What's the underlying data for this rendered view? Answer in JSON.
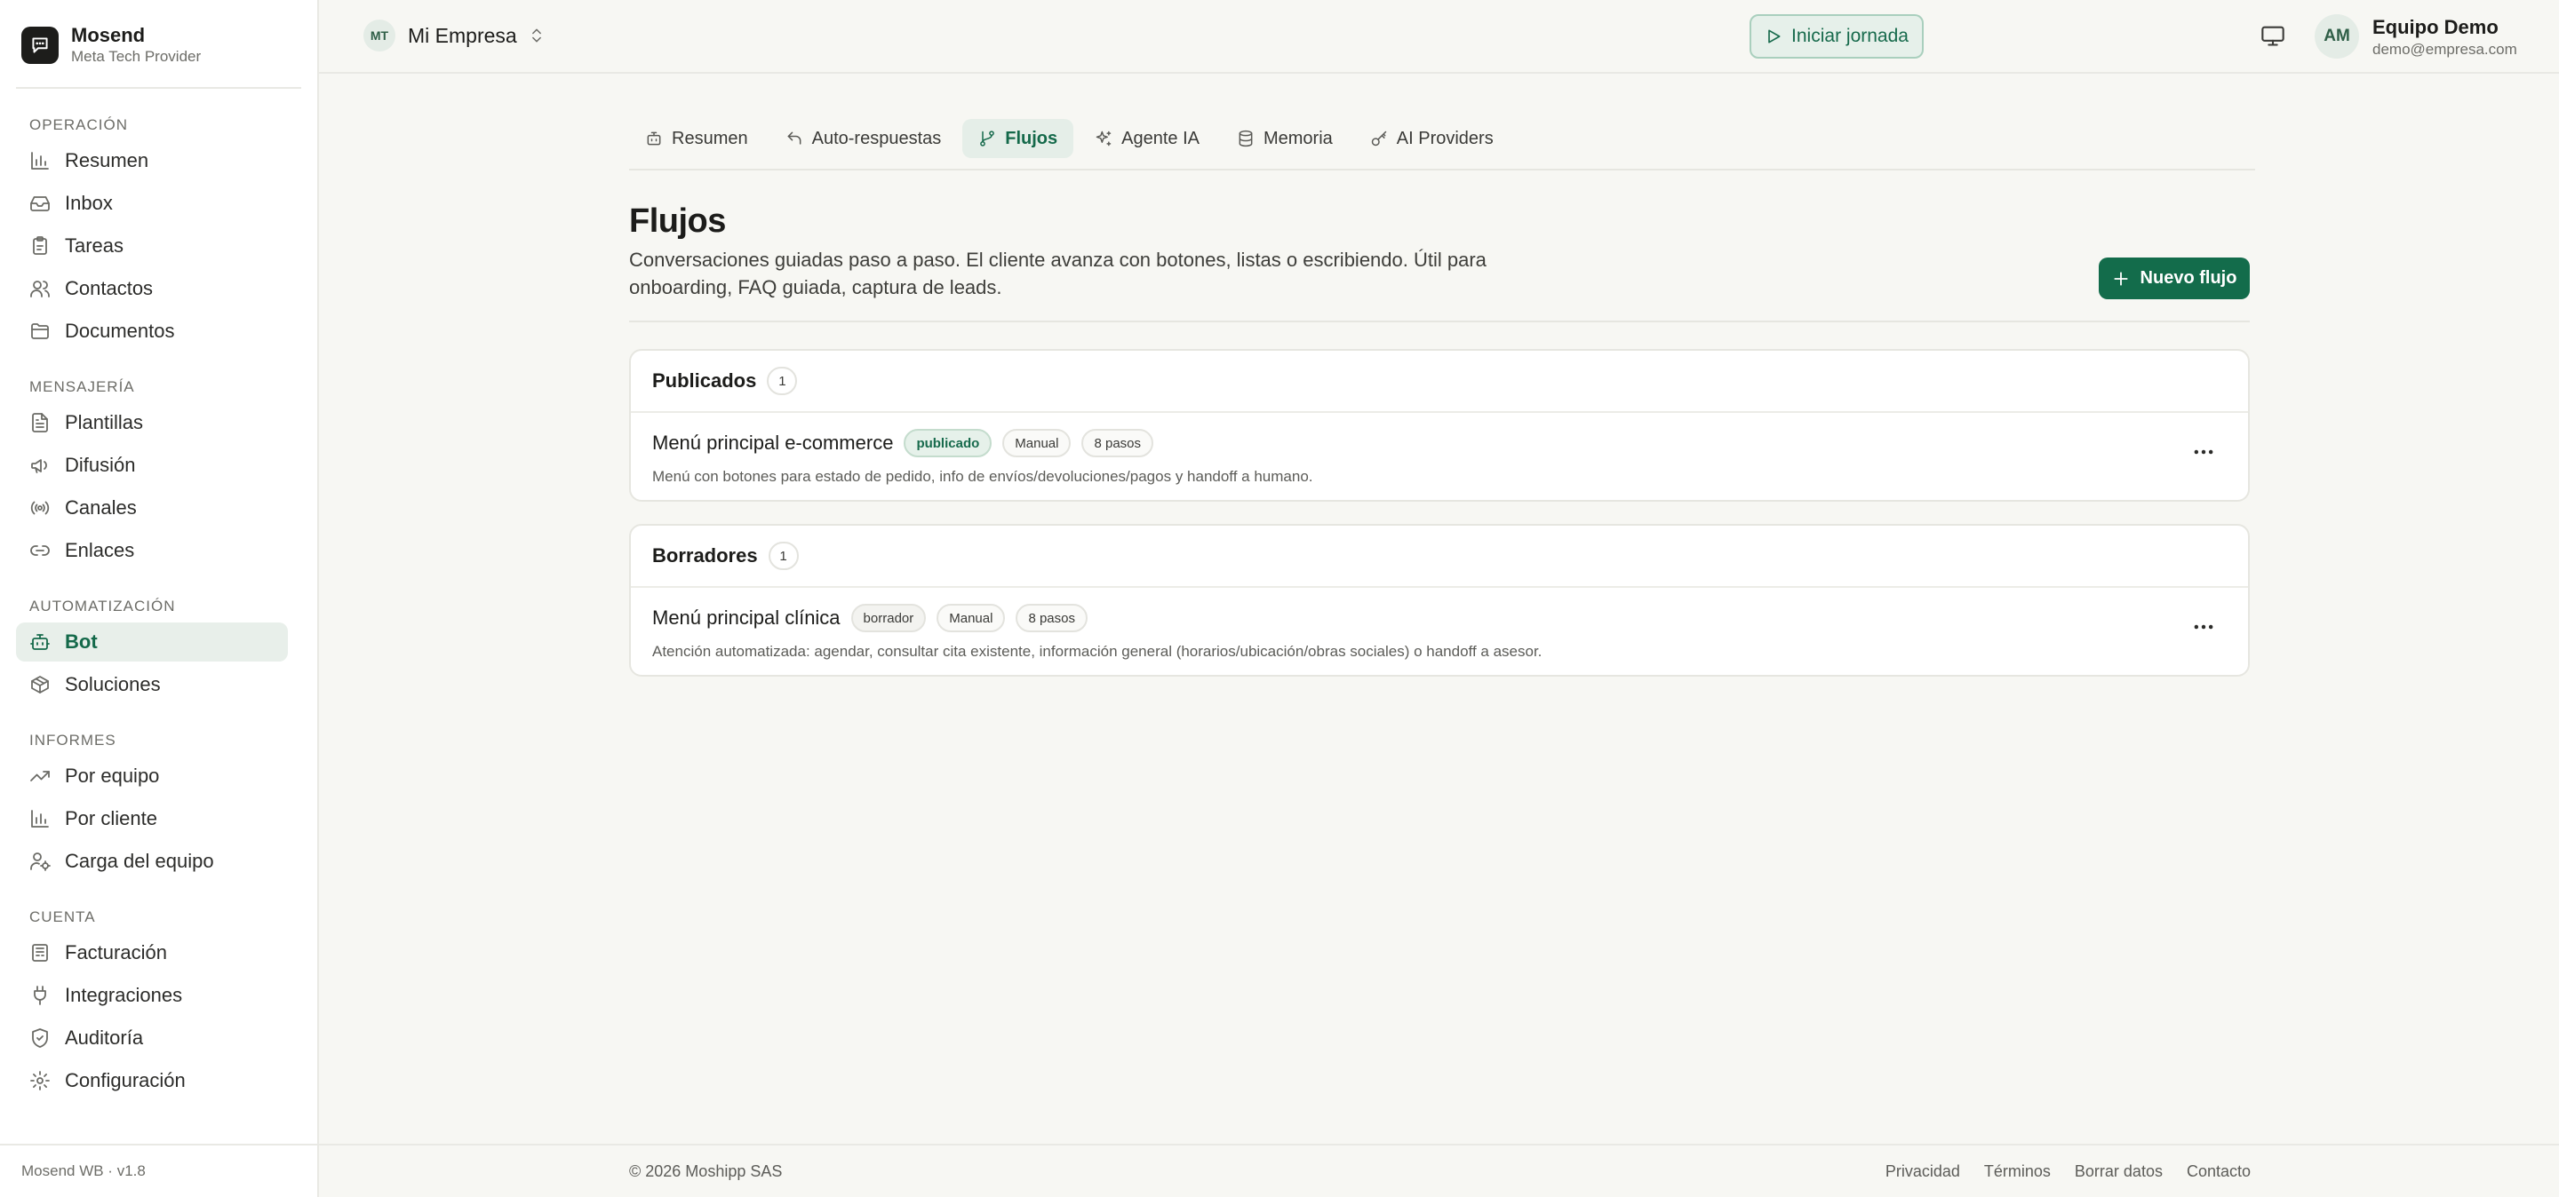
{
  "brand": {
    "name": "Mosend",
    "subtitle": "Meta Tech Provider"
  },
  "sidebar": {
    "sections": [
      {
        "title": "Operación",
        "items": [
          {
            "label": "Resumen",
            "icon": "bar-chart-icon"
          },
          {
            "label": "Inbox",
            "icon": "inbox-icon"
          },
          {
            "label": "Tareas",
            "icon": "clipboard-icon"
          },
          {
            "label": "Contactos",
            "icon": "users-icon"
          },
          {
            "label": "Documentos",
            "icon": "folder-icon"
          }
        ]
      },
      {
        "title": "Mensajería",
        "items": [
          {
            "label": "Plantillas",
            "icon": "file-text-icon"
          },
          {
            "label": "Difusión",
            "icon": "megaphone-icon"
          },
          {
            "label": "Canales",
            "icon": "radio-icon"
          },
          {
            "label": "Enlaces",
            "icon": "link-icon"
          }
        ]
      },
      {
        "title": "Automatización",
        "items": [
          {
            "label": "Bot",
            "icon": "bot-icon",
            "active": true
          },
          {
            "label": "Soluciones",
            "icon": "package-icon"
          }
        ]
      },
      {
        "title": "Informes",
        "items": [
          {
            "label": "Por equipo",
            "icon": "trending-up-icon"
          },
          {
            "label": "Por cliente",
            "icon": "bar-chart-icon"
          },
          {
            "label": "Carga del equipo",
            "icon": "user-cog-icon"
          }
        ]
      },
      {
        "title": "Cuenta",
        "items": [
          {
            "label": "Facturación",
            "icon": "receipt-icon"
          },
          {
            "label": "Integraciones",
            "icon": "plug-icon"
          },
          {
            "label": "Auditoría",
            "icon": "shield-icon"
          },
          {
            "label": "Configuración",
            "icon": "gear-icon"
          }
        ]
      }
    ],
    "footer": "Mosend WB · v1.8"
  },
  "topbar": {
    "workspace_initials": "MT",
    "workspace_name": "Mi Empresa",
    "start_label": "Iniciar jornada",
    "user_initials": "AM",
    "user_name": "Equipo Demo",
    "user_email": "demo@empresa.com"
  },
  "tabs": [
    {
      "label": "Resumen",
      "icon": "bot-icon"
    },
    {
      "label": "Auto-respuestas",
      "icon": "reply-icon"
    },
    {
      "label": "Flujos",
      "icon": "git-branch-icon",
      "active": true
    },
    {
      "label": "Agente IA",
      "icon": "sparkles-icon"
    },
    {
      "label": "Memoria",
      "icon": "database-icon"
    },
    {
      "label": "AI Providers",
      "icon": "key-icon"
    }
  ],
  "page": {
    "title": "Flujos",
    "description": "Conversaciones guiadas paso a paso. El cliente avanza con botones, listas o escribiendo. Útil para onboarding, FAQ guiada, captura de leads.",
    "new_button": "Nuevo flujo"
  },
  "groups": [
    {
      "title": "Publicados",
      "count": "1",
      "flows": [
        {
          "name": "Menú principal e-commerce",
          "status": "publicado",
          "trigger": "Manual",
          "steps": "8 pasos",
          "description": "Menú con botones para estado de pedido, info de envíos/devoluciones/pagos y handoff a humano."
        }
      ]
    },
    {
      "title": "Borradores",
      "count": "1",
      "flows": [
        {
          "name": "Menú principal clínica",
          "status": "borrador",
          "trigger": "Manual",
          "steps": "8 pasos",
          "description": "Atención automatizada: agendar, consultar cita existente, información general (horarios/ubicación/obras sociales) o handoff a asesor."
        }
      ]
    }
  ],
  "footer": {
    "copyright": "© 2026 Moshipp SAS",
    "links": [
      "Privacidad",
      "Términos",
      "Borrar datos",
      "Contacto"
    ]
  },
  "colors": {
    "accent": "#136c4b",
    "accent_soft": "#e6f0ea",
    "background": "#f7f7f3",
    "sidebar": "#ffffff"
  }
}
